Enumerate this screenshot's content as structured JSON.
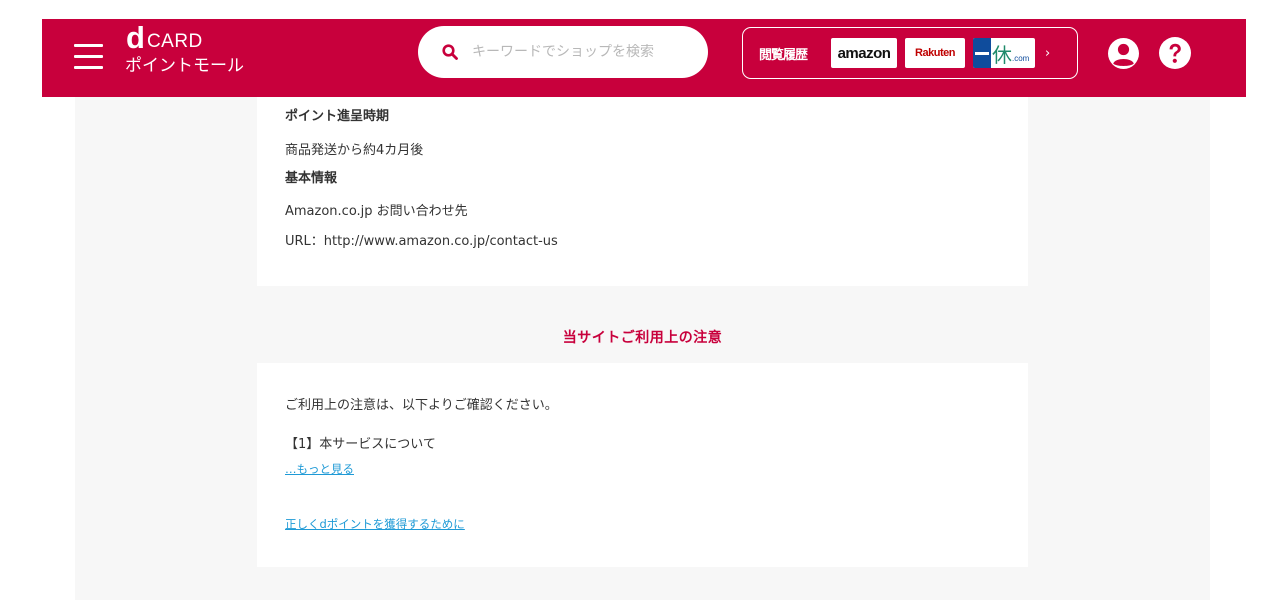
{
  "header": {
    "logo_d": "d",
    "logo_card": "CARD",
    "logo_sub": "ポイントモール",
    "search_placeholder": "キーワードでショップを検索",
    "history_label": "閲覧履歴",
    "history_shops": [
      "amazon",
      "Rakuten",
      "一休.com"
    ],
    "history_arrow": "›",
    "icons": [
      "menu-icon",
      "search-icon",
      "user-icon",
      "help-icon",
      "chevron-right-icon"
    ]
  },
  "shop_info": {
    "point_timing_heading": "ポイント進呈時期",
    "point_timing_value": "商品発送から約4カ月後",
    "basic_info_heading": "基本情報",
    "contact_label": "Amazon.co.jp お問い合わせ先",
    "contact_url": "URL：http://www.amazon.co.jp/contact-us"
  },
  "notes": {
    "section_title": "当サイトご利用上の注意",
    "intro": "ご利用上の注意は、以下よりご確認ください。",
    "item1": "【1】本サービスについて",
    "more_link": "…もっと見る",
    "guide_link": "正しくdポイントを獲得するために"
  },
  "colors": {
    "brand": "#c8003c",
    "link": "#1f9ad6",
    "background": "#f7f7f7"
  }
}
